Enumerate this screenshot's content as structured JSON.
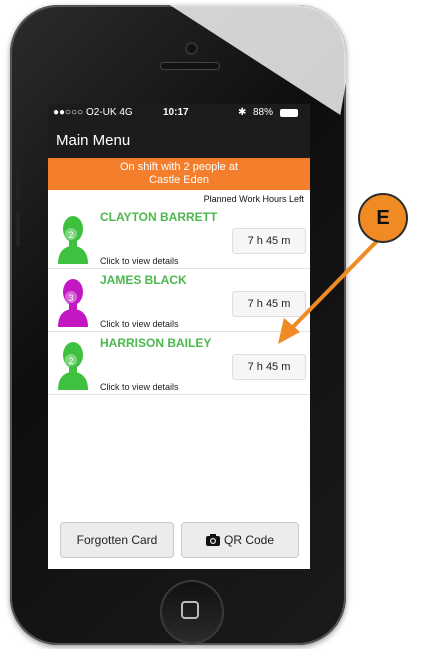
{
  "status": {
    "carrier": "●●○○○ O2-UK  4G",
    "time": "10:17",
    "battery": "88%"
  },
  "nav": {
    "title": "Main Menu"
  },
  "banner": {
    "line1": "On shift with 2 people at",
    "line2": "Castle Eden"
  },
  "list_header": "Planned Work Hours Left",
  "people": [
    {
      "name": "CLAYTON BARRETT",
      "hours": "7 h 45 m",
      "details": "Click to view details",
      "badge": "2",
      "color": "#3ec13e",
      "name_color": "#4cb84c"
    },
    {
      "name": "JAMES BLACK",
      "hours": "7 h 45 m",
      "details": "Click to view details",
      "badge": "3",
      "color": "#c317c3",
      "name_color": "#4cb84c"
    },
    {
      "name": "HARRISON BAILEY",
      "hours": "7 h 45 m",
      "details": "Click to view details",
      "badge": "2",
      "color": "#3ec13e",
      "name_color": "#4cb84c"
    }
  ],
  "buttons": {
    "forgotten": "Forgotten Card",
    "qr": "QR Code"
  },
  "callout": {
    "label": "E",
    "color": "#f08a22"
  }
}
